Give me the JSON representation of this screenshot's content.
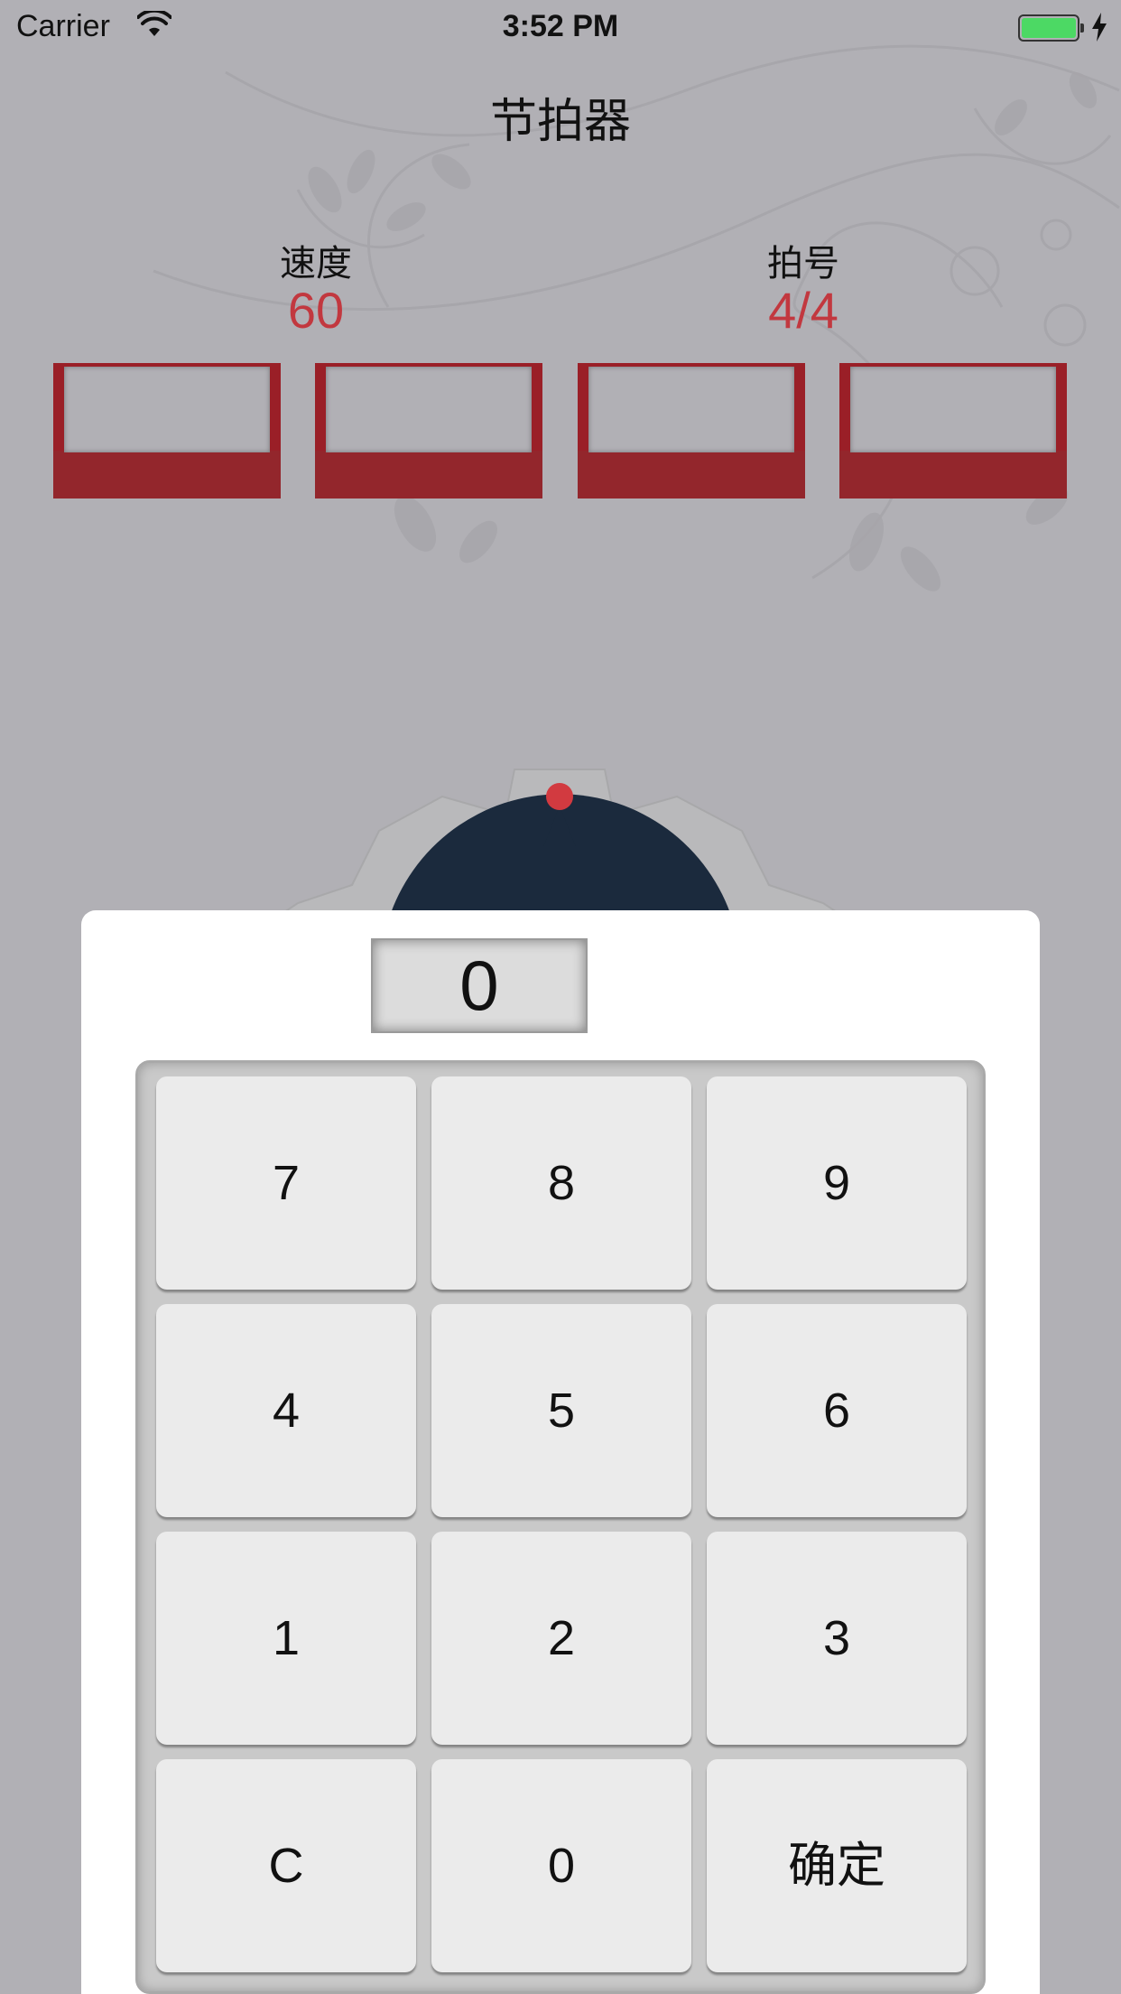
{
  "status_bar": {
    "carrier": "Carrier",
    "time": "3:52 PM",
    "wifi_icon": "wifi-icon",
    "battery_icon": "battery-charging-icon",
    "battery_color": "#4cd964"
  },
  "header": {
    "title": "节拍器"
  },
  "stats": {
    "speed": {
      "label": "速度",
      "value": "60"
    },
    "meter": {
      "label": "拍号",
      "value": "4/4"
    }
  },
  "beat_indicators": {
    "count": 4,
    "color": "#9a1f27"
  },
  "keypad": {
    "display_value": "0",
    "keys": [
      "7",
      "8",
      "9",
      "4",
      "5",
      "6",
      "1",
      "2",
      "3",
      "C",
      "0",
      "确定"
    ]
  },
  "colors": {
    "background": "#b1b0b5",
    "accent_red": "#c2383f",
    "dial_dark": "#1b2a3d"
  }
}
